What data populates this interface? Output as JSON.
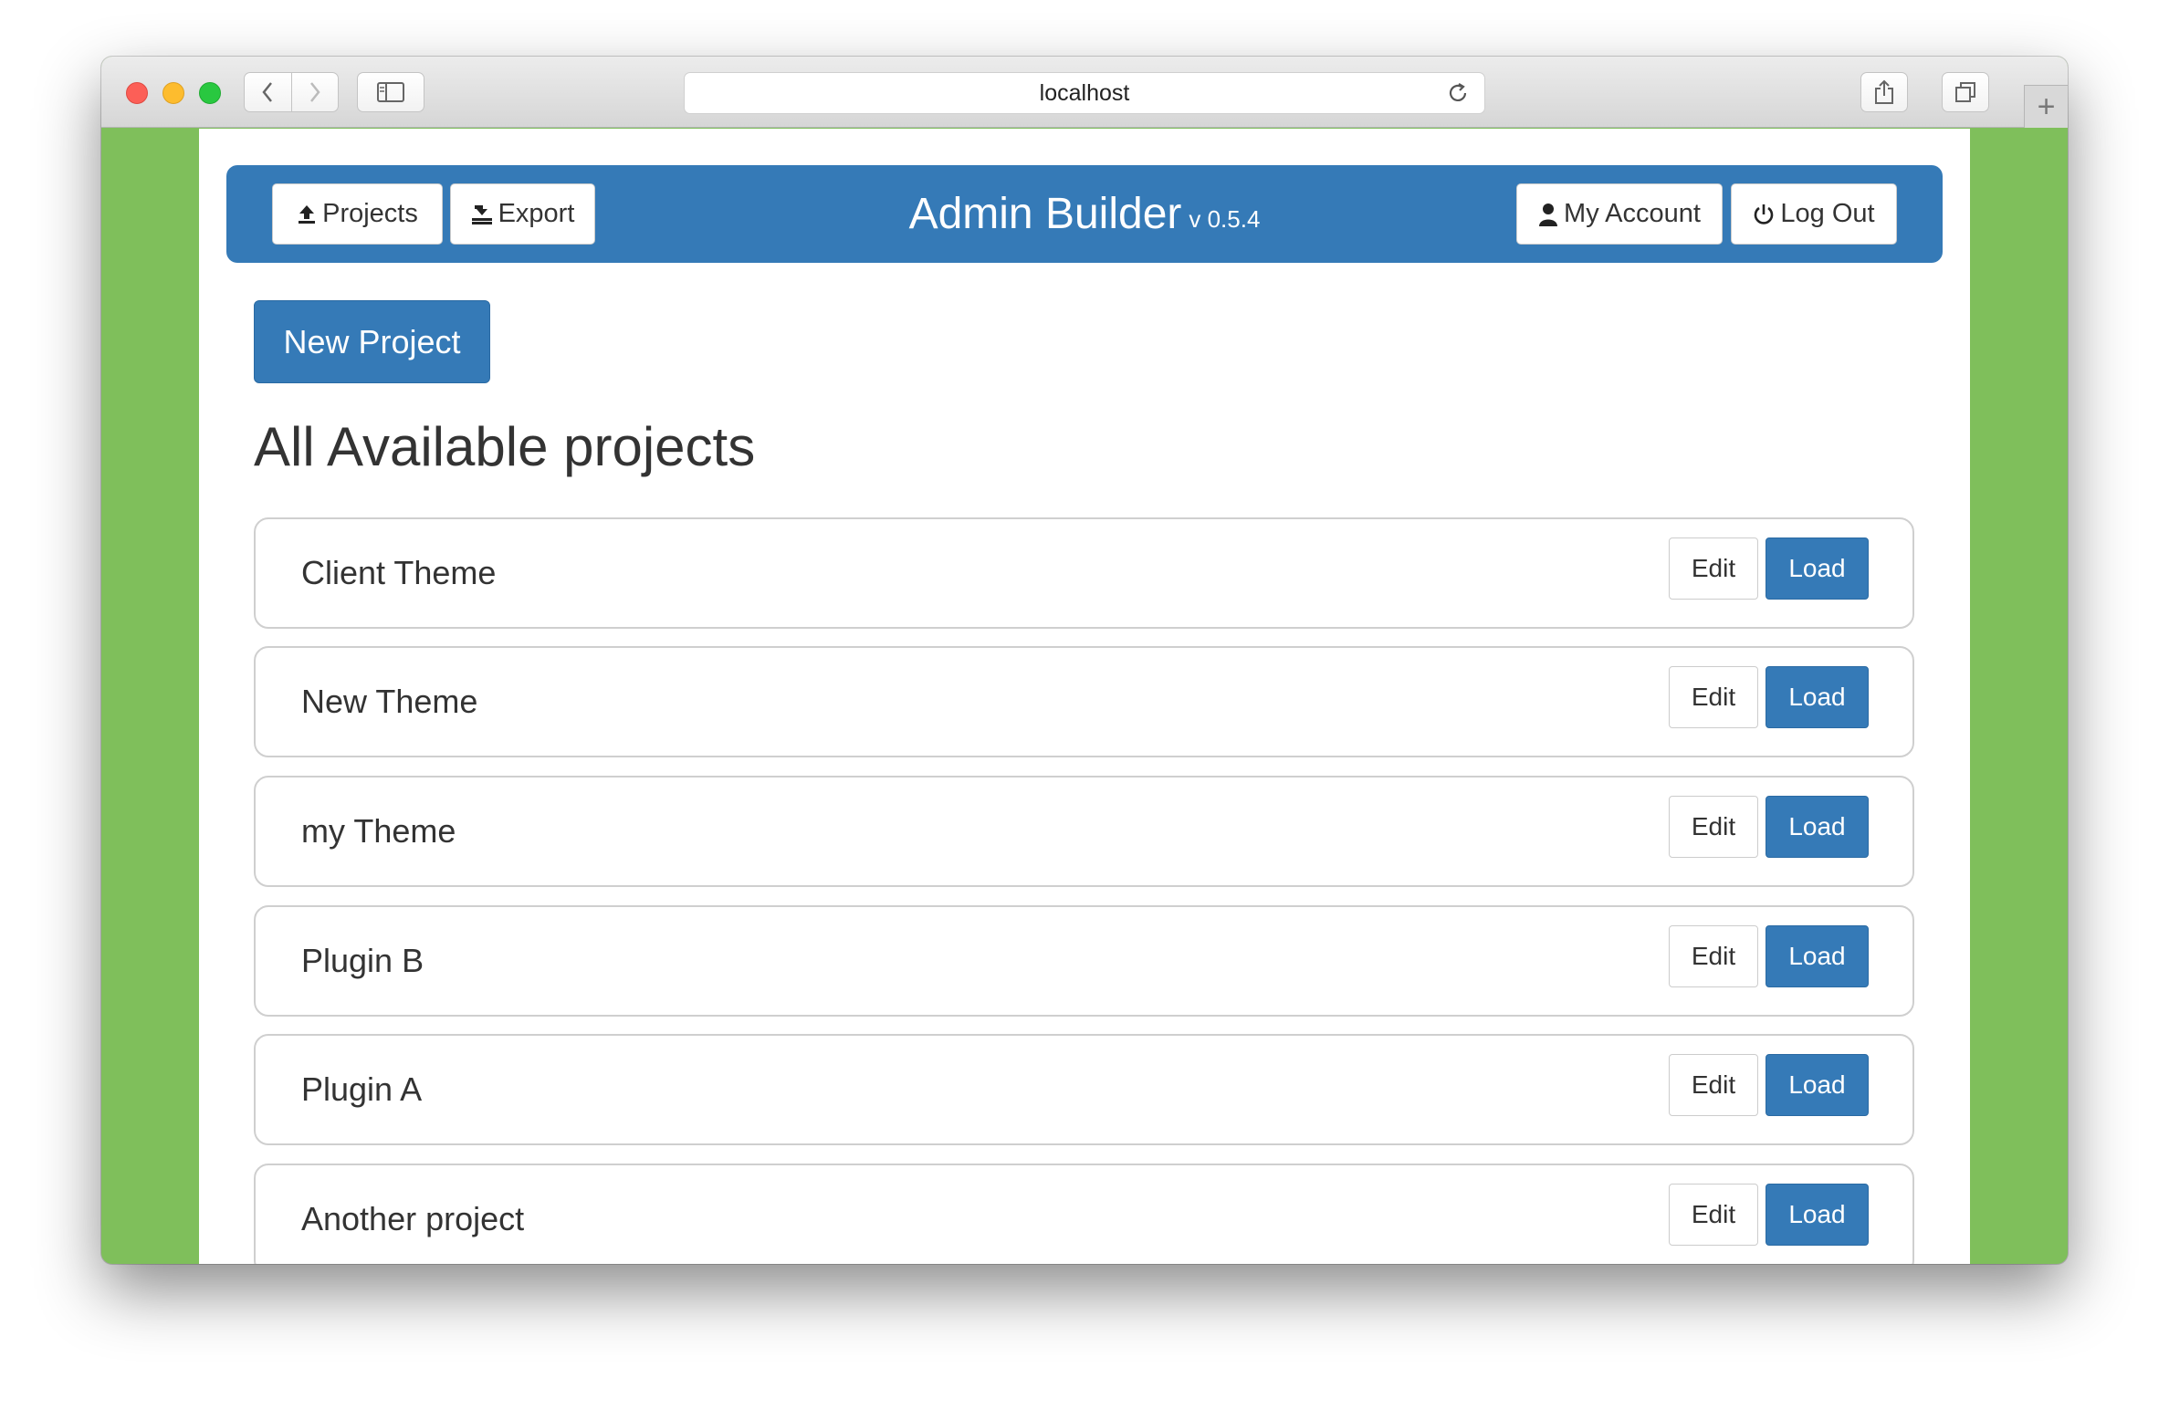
{
  "browser": {
    "url": "localhost",
    "colors": {
      "page_bg": "#7fbf5b",
      "chrome": "#e3e3e3"
    }
  },
  "navbar": {
    "projects_label": "Projects",
    "export_label": "Export",
    "title": "Admin Builder",
    "version": "v 0.5.4",
    "account_label": "My Account",
    "logout_label": "Log Out",
    "colors": {
      "bar": "#357ab7"
    }
  },
  "main": {
    "new_project_label": "New Project",
    "section_title": "All Available projects",
    "projects": [
      {
        "name": "Client Theme",
        "edit_label": "Edit",
        "load_label": "Load"
      },
      {
        "name": "New Theme",
        "edit_label": "Edit",
        "load_label": "Load"
      },
      {
        "name": "my Theme",
        "edit_label": "Edit",
        "load_label": "Load"
      },
      {
        "name": "Plugin B",
        "edit_label": "Edit",
        "load_label": "Load"
      },
      {
        "name": "Plugin A",
        "edit_label": "Edit",
        "load_label": "Load"
      },
      {
        "name": "Another project",
        "edit_label": "Edit",
        "load_label": "Load"
      }
    ],
    "colors": {
      "primary": "#357ab7"
    }
  }
}
